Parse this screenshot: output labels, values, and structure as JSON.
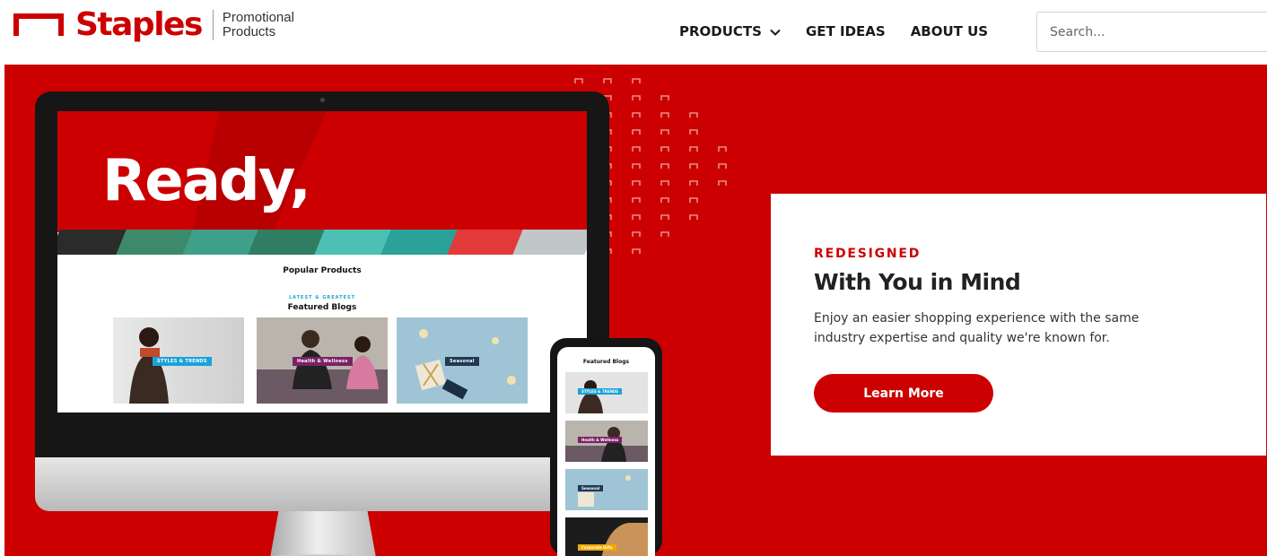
{
  "header": {
    "brand": "Staples",
    "brand_sub": "Promotional Products",
    "nav": [
      {
        "label": "PRODUCTS",
        "has_dropdown": true
      },
      {
        "label": "GET IDEAS"
      },
      {
        "label": "ABOUT US"
      }
    ],
    "search": {
      "placeholder": "Search...",
      "value": ""
    }
  },
  "hero": {
    "background_color": "#cc0000",
    "monitor_screen": {
      "headline": "Ready,",
      "popular_heading": "Popular Products",
      "latest_label": "LATEST & GREATEST",
      "featured_heading": "Featured Blogs",
      "blog_cards": [
        {
          "tag": "STYLES & TRENDS",
          "tag_color": "#1aa3d8"
        },
        {
          "tag": "Health & Wellness",
          "tag_color": "#7a2268"
        },
        {
          "tag": "Seasonal",
          "tag_color": "#1f3a52"
        }
      ]
    },
    "phone_screen": {
      "heading": "Featured Blogs",
      "cards": [
        {
          "tag": "STYLES & TRENDS",
          "tag_color": "#1aa3d8"
        },
        {
          "tag": "Health & Wellness",
          "tag_color": "#7a2268"
        },
        {
          "tag": "Seasonal",
          "tag_color": "#1f3a52"
        },
        {
          "tag": "Corporate Gifts",
          "tag_color": "#f2a900"
        }
      ]
    },
    "card": {
      "eyebrow": "REDESIGNED",
      "title": "With You in Mind",
      "body": "Enjoy an easier shopping experience with the same industry expertise and quality we're known for.",
      "cta": "Learn More"
    }
  }
}
